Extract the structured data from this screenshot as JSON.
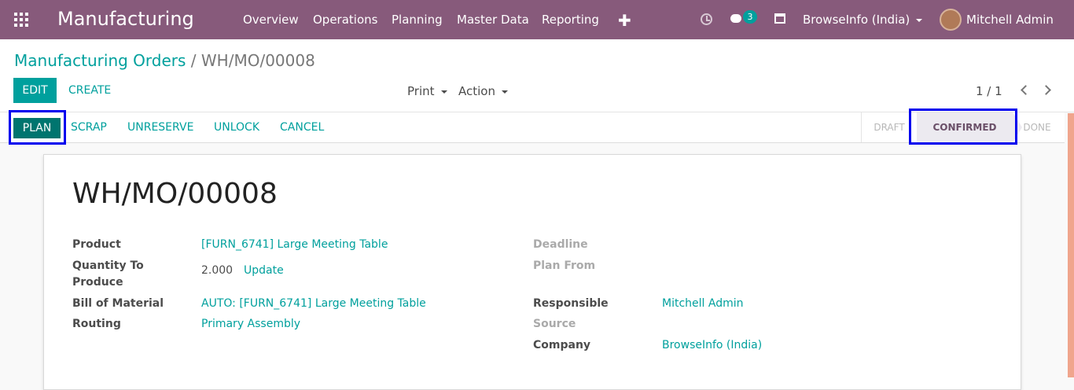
{
  "topbar": {
    "app_title": "Manufacturing",
    "menu": [
      "Overview",
      "Operations",
      "Planning",
      "Master Data",
      "Reporting"
    ],
    "plus": "✚",
    "chat_count": "3",
    "company": "BrowseInfo (India)",
    "user": "Mitchell Admin"
  },
  "breadcrumb": {
    "parent": "Manufacturing Orders",
    "separator": "/",
    "current": "WH/MO/00008"
  },
  "buttons": {
    "edit": "EDIT",
    "create": "CREATE",
    "print": "Print",
    "action": "Action"
  },
  "pager": {
    "value": "1 / 1"
  },
  "status_actions": {
    "plan": "PLAN",
    "scrap": "SCRAP",
    "unreserve": "UNRESERVE",
    "unlock": "UNLOCK",
    "cancel": "CANCEL"
  },
  "stages": {
    "draft": "DRAFT",
    "confirmed": "CONFIRMED",
    "done": "DONE"
  },
  "record": {
    "title": "WH/MO/00008",
    "product_label": "Product",
    "product": "[FURN_6741] Large Meeting Table",
    "quantity_label_1": "Quantity To",
    "quantity_label_2": "Produce",
    "quantity": "2.000",
    "update": "Update",
    "bom_label": "Bill of Material",
    "bom": "AUTO: [FURN_6741] Large Meeting Table",
    "routing_label": "Routing",
    "routing": "Primary Assembly",
    "deadline_label": "Deadline",
    "plan_from_label": "Plan From",
    "responsible_label": "Responsible",
    "responsible": "Mitchell Admin",
    "source_label": "Source",
    "company_label": "Company",
    "company": "BrowseInfo (India)"
  },
  "colors": {
    "topbar": "#875a7b",
    "primary": "#00a09d",
    "plan_button": "#00756f",
    "highlight_outline": "#0000ee"
  }
}
